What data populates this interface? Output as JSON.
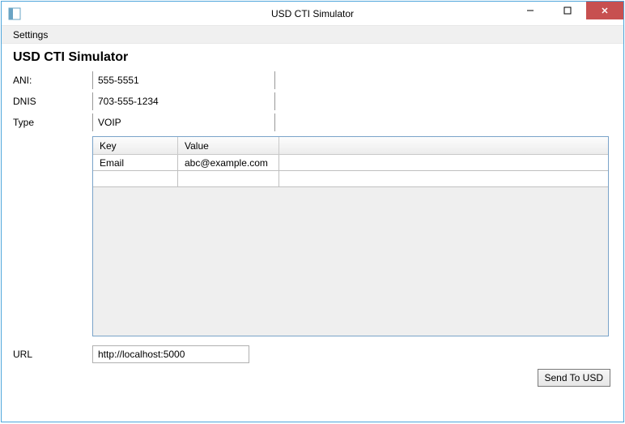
{
  "window": {
    "title": "USD CTI Simulator"
  },
  "menu": {
    "settings": "Settings"
  },
  "heading": "USD CTI Simulator",
  "fields": {
    "ani": {
      "label": "ANI:",
      "value": "555-5551"
    },
    "dnis": {
      "label": "DNIS",
      "value": "703-555-1234"
    },
    "type": {
      "label": "Type",
      "value": "VOIP"
    },
    "url": {
      "label": "URL",
      "value": "http://localhost:5000"
    }
  },
  "grid": {
    "headers": {
      "key": "Key",
      "value": "Value"
    },
    "rows": [
      {
        "key": "Email",
        "value": "abc@example.com"
      },
      {
        "key": "",
        "value": ""
      }
    ]
  },
  "buttons": {
    "send": "Send To USD"
  }
}
